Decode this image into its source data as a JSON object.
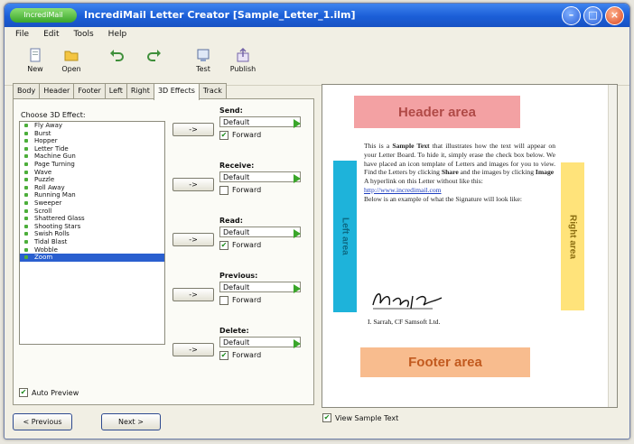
{
  "window": {
    "app_badge": "IncrediMail",
    "title": "IncrediMail Letter Creator [Sample_Letter_1.ilm]",
    "controls": {
      "minimize": "–",
      "maximize": "□",
      "close": "×"
    }
  },
  "menu": [
    "File",
    "Edit",
    "Tools",
    "Help"
  ],
  "toolbar": [
    {
      "label": "New",
      "icon": "new-document-icon"
    },
    {
      "label": "Open",
      "icon": "open-folder-icon"
    },
    {
      "label": "",
      "icon": "undo-icon"
    },
    {
      "label": "",
      "icon": "redo-icon"
    },
    {
      "label": "Test",
      "icon": "test-letter-icon"
    },
    {
      "label": "Publish",
      "icon": "publish-icon"
    }
  ],
  "tabs": [
    "Body",
    "Header",
    "Footer",
    "Left",
    "Right",
    "3D Effects",
    "Track"
  ],
  "active_tab": "3D Effects",
  "effects": {
    "list_caption": "Choose 3D Effect:",
    "items": [
      "Fly Away",
      "Burst",
      "Hopper",
      "Letter Tide",
      "Machine Gun",
      "Page Turning",
      "Wave",
      "Puzzle",
      "Roll Away",
      "Running Man",
      "Sweeper",
      "Scroll",
      "Shattered Glass",
      "Shooting Stars",
      "Swish Rolls",
      "Tidal Blast",
      "Wobble",
      "Zoom"
    ],
    "selected": "Zoom",
    "arrow_label": "->",
    "groups": [
      {
        "label": "Send:",
        "value": "Default",
        "forward_label": "Forward",
        "forward_checked": true
      },
      {
        "label": "Receive:",
        "value": "Default",
        "forward_label": "Forward",
        "forward_checked": false
      },
      {
        "label": "Read:",
        "value": "Default",
        "forward_label": "Forward",
        "forward_checked": true
      },
      {
        "label": "Previous:",
        "value": "Default",
        "forward_label": "Forward",
        "forward_checked": false
      },
      {
        "label": "Delete:",
        "value": "Default",
        "forward_label": "Forward",
        "forward_checked": true
      }
    ],
    "auto_preview_label": "Auto Preview",
    "auto_preview_checked": true
  },
  "nav": {
    "previous": "< Previous",
    "next": "Next >"
  },
  "preview": {
    "header_area": "Header area",
    "footer_area": "Footer area",
    "left_area": "Left area",
    "right_area": "Right area",
    "letter_p1_pre": "This is a ",
    "letter_p1_bold": "Sample Text",
    "letter_p1_post": " that illustrates how the text will appear on your Letter Board. To hide it, simply erase the check box below. We have placed an icon template of Letters and images for you to view. Find the Letters by clicking ",
    "letter_p1_bold2": "Share",
    "letter_p1_post2": " and the images by clicking ",
    "letter_p1_bold3": "Image",
    "letter_p2": "A hyperlink on this Letter without like this:",
    "letter_link": "http://www.incredimail.com",
    "letter_p3": "Below is an example of what the Signature will look like:",
    "sig_name": "I. Sarrah, CF Samsoft Ltd.",
    "view_sample_label": "View Sample Text",
    "view_sample_checked": true
  }
}
